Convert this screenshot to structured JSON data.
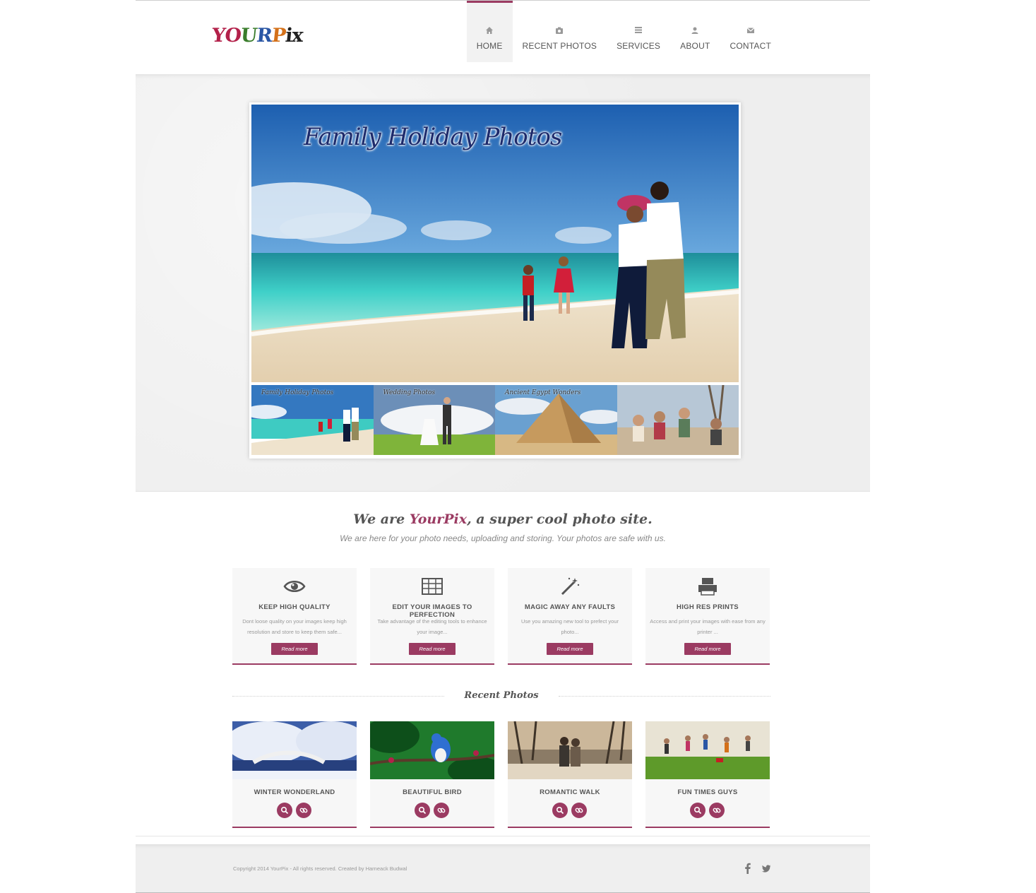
{
  "header": {
    "logo_letters": [
      "Y",
      "O",
      "U",
      "R",
      "P",
      "i",
      "x"
    ],
    "logo_colors": [
      "#b3214a",
      "#b3214a",
      "#3a7d2c",
      "#2b57a5",
      "#d4711a",
      "#222222",
      "#222222"
    ],
    "nav": [
      {
        "label": "HOME",
        "icon": "home-icon",
        "active": true
      },
      {
        "label": "RECENT PHOTOS",
        "icon": "camera-icon",
        "active": false
      },
      {
        "label": "SERVICES",
        "icon": "list-icon",
        "active": false
      },
      {
        "label": "ABOUT",
        "icon": "user-icon",
        "active": false
      },
      {
        "label": "CONTACT",
        "icon": "envelope-icon",
        "active": false
      }
    ]
  },
  "slider": {
    "caption": "Family Holiday Photos",
    "thumbs": [
      {
        "caption": "Family Holiday Photos"
      },
      {
        "caption": "Wedding Photos"
      },
      {
        "caption": "Ancient Egypt Wonders"
      },
      {
        "caption": ""
      }
    ]
  },
  "intro": {
    "title_before": "We are ",
    "title_brand": "YourPix",
    "title_after": ", a super cool photo site.",
    "subtitle": "We are here for your photo needs, uploading and storing. Your photos are safe with us."
  },
  "features": [
    {
      "icon": "eye-icon",
      "title": "KEEP HIGH QUALITY",
      "text": "Dont loose quality on your images keep high resolution and store to keep them safe...",
      "button": "Read more"
    },
    {
      "icon": "table-icon",
      "title": "EDIT YOUR IMAGES TO PERFECTION",
      "text": "Take advantage of the editing tools to enhance your image...",
      "button": "Read more"
    },
    {
      "icon": "magic-wand-icon",
      "title": "MAGIC AWAY ANY FAULTS",
      "text": "Use you amazing new tool to prefect your photo...",
      "button": "Read more"
    },
    {
      "icon": "printer-icon",
      "title": "HIGH RES PRINTS",
      "text": "Access and print your images with ease from any printer ...",
      "button": "Read more"
    }
  ],
  "recent": {
    "title": "Recent Photos",
    "photos": [
      {
        "title": "WINTER WONDERLAND"
      },
      {
        "title": "BEAUTIFUL BIRD"
      },
      {
        "title": "ROMANTIC WALK"
      },
      {
        "title": "FUN TIMES GUYS"
      }
    ]
  },
  "footer": {
    "copyright": "Copyright 2014 YourPix - All rights reserved. Created by Harneack Budwal",
    "social": [
      "facebook-icon",
      "twitter-icon"
    ]
  },
  "colors": {
    "accent": "#9b3b62"
  }
}
